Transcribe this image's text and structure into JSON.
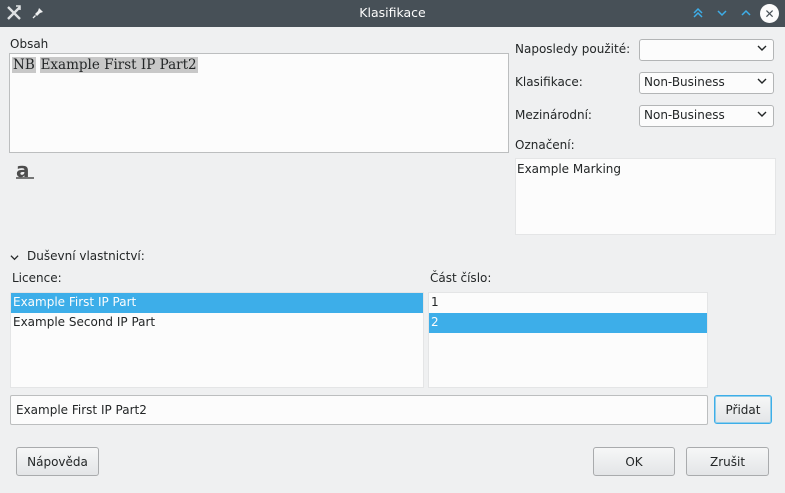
{
  "window": {
    "title": "Klasifikace"
  },
  "content": {
    "label": "Obsah",
    "prefix": "NB",
    "text": "Example First IP Part2"
  },
  "recent": {
    "label": "Naposledy použité:",
    "value": ""
  },
  "classification": {
    "label": "Klasifikace:",
    "value": "Non-Business"
  },
  "international": {
    "label": "Mezinárodní:",
    "value": "Non-Business"
  },
  "marking": {
    "label": "Označení:",
    "value": "Example Marking"
  },
  "ip": {
    "section_label": "Duševní vlastnictví:",
    "licence_label": "Licence:",
    "part_label": "Část číslo:",
    "licences": [
      "Example First IP Part",
      "Example Second IP Part"
    ],
    "parts": [
      "1",
      "2"
    ],
    "input_value": "Example First IP Part2",
    "add_button": "Přidat"
  },
  "buttons": {
    "help": "Nápověda",
    "ok": "OK",
    "cancel": "Zrušit"
  }
}
